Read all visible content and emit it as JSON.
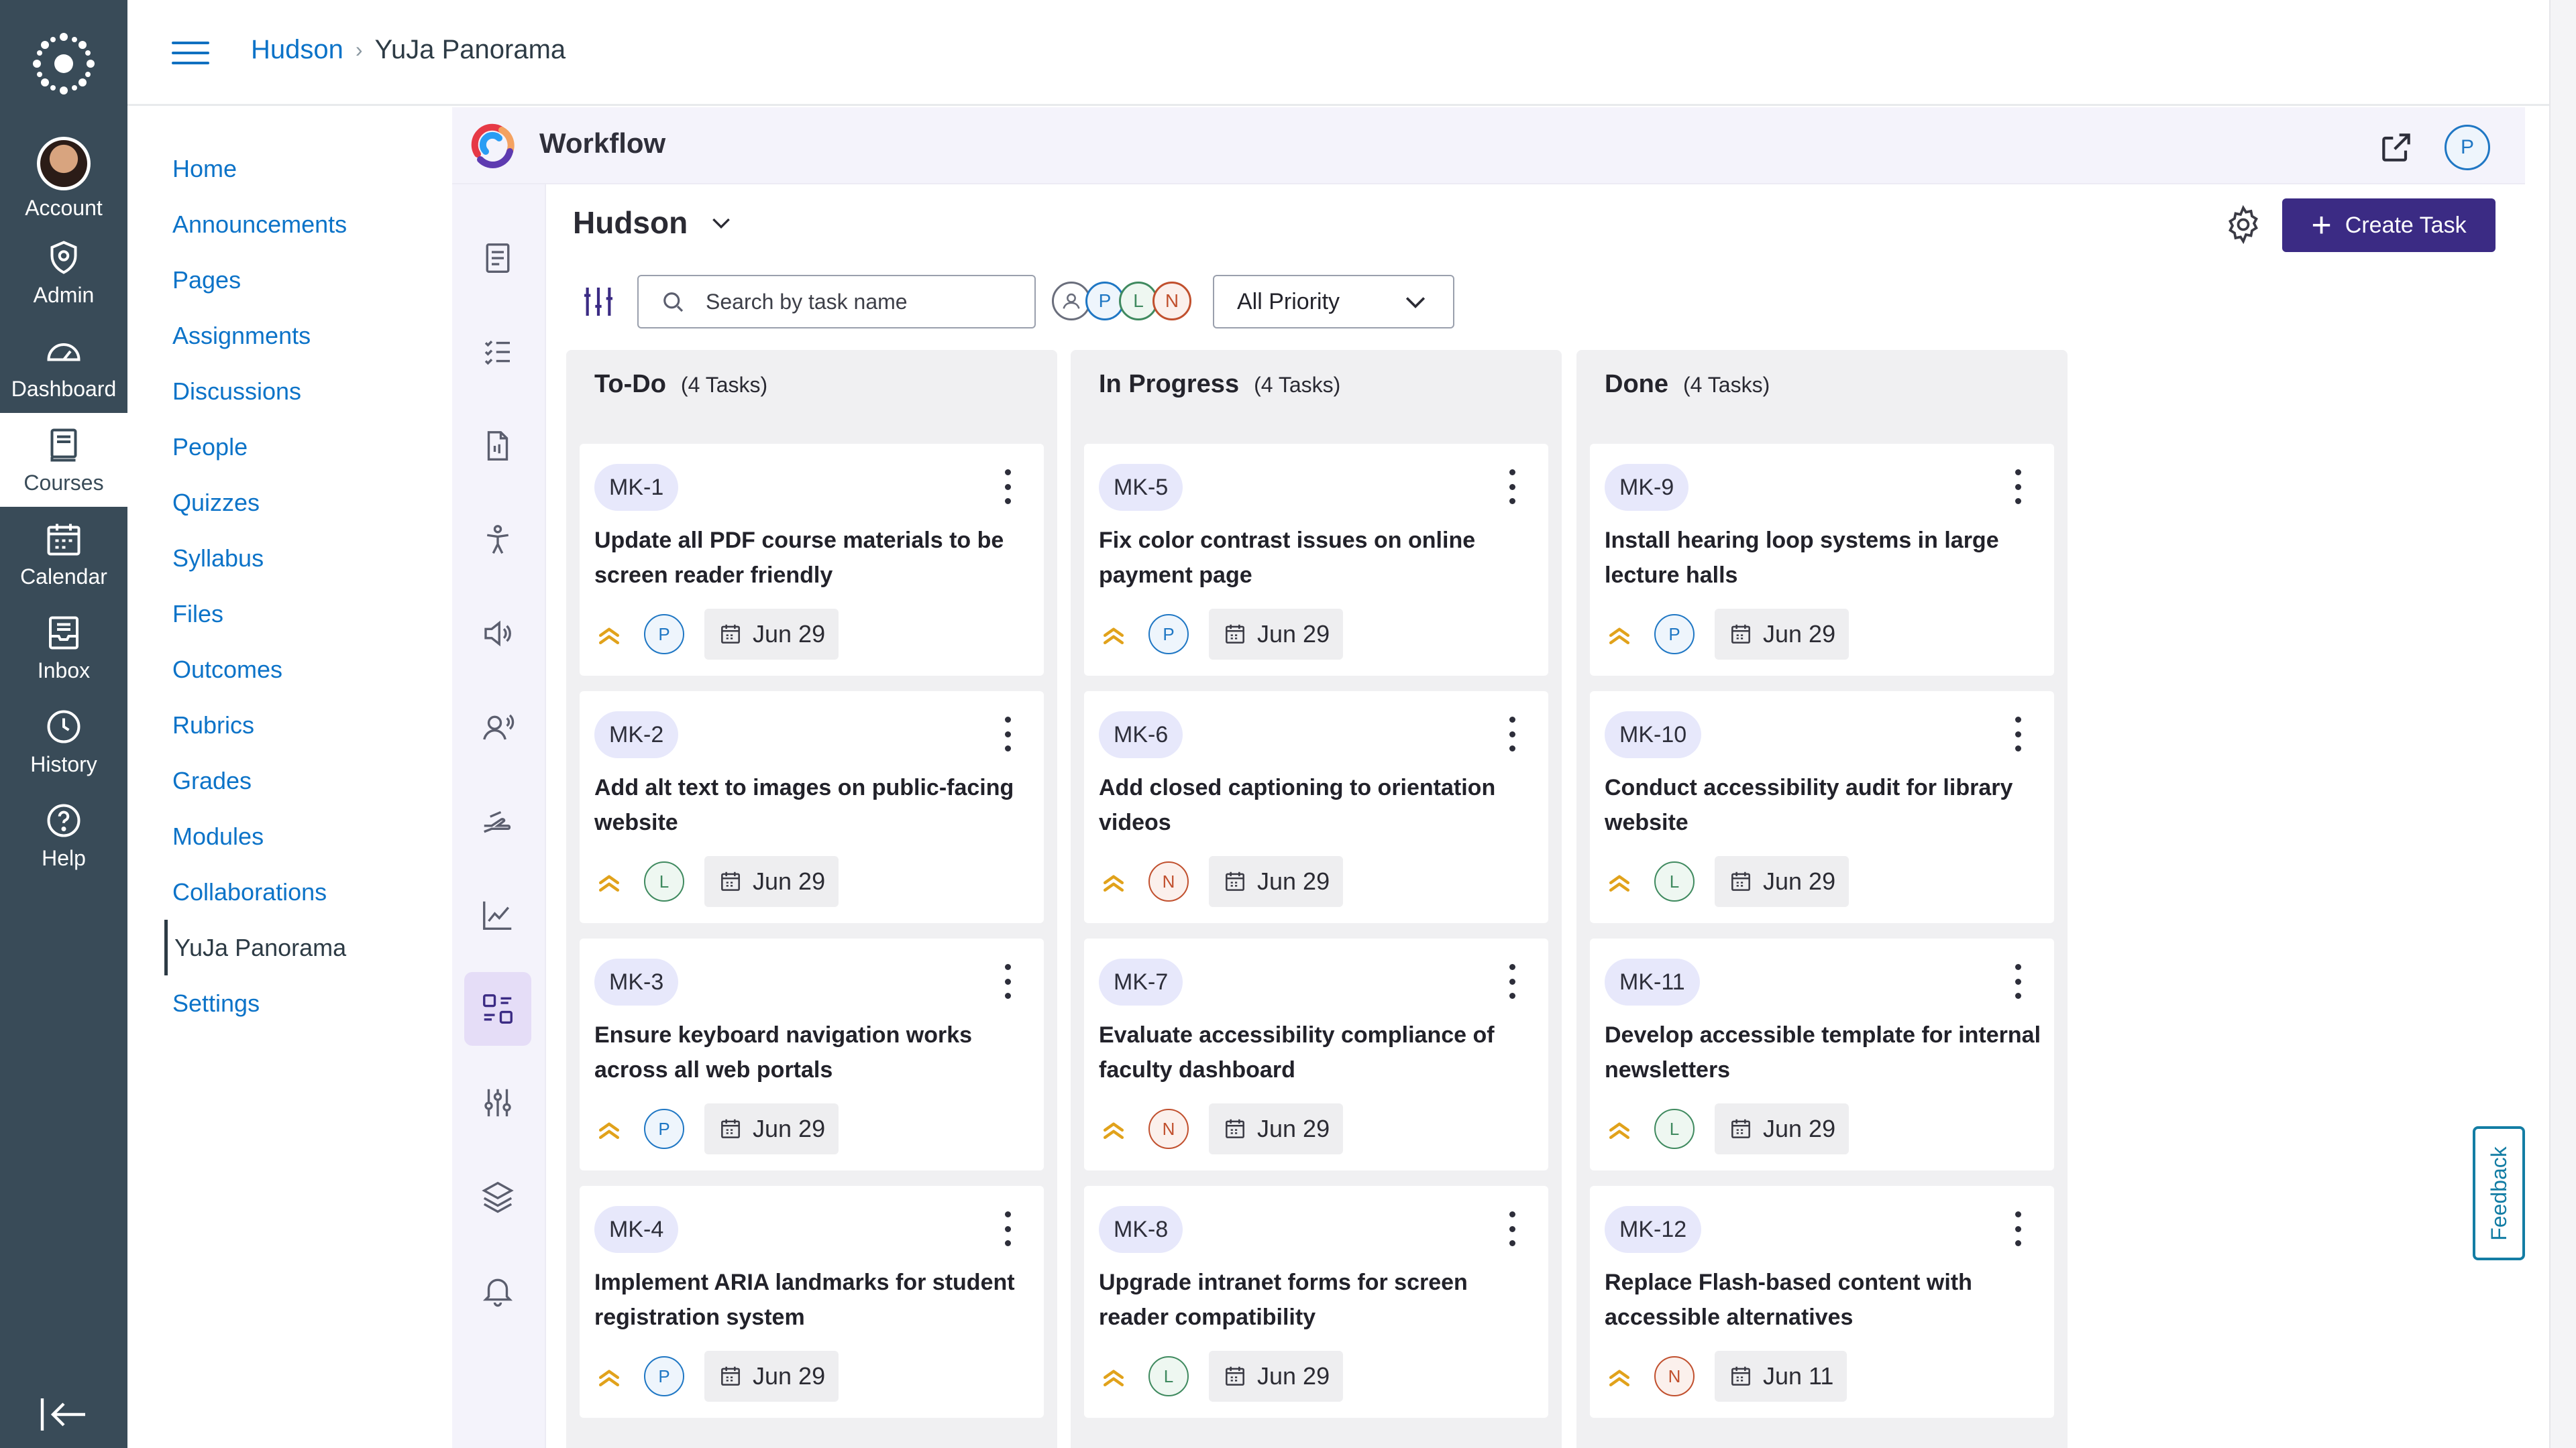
{
  "global_nav": {
    "items": [
      {
        "label": "Account",
        "icon": "account-avatar"
      },
      {
        "label": "Admin",
        "icon": "shield-icon"
      },
      {
        "label": "Dashboard",
        "icon": "speedometer-icon"
      },
      {
        "label": "Courses",
        "icon": "book-icon",
        "active": true
      },
      {
        "label": "Calendar",
        "icon": "calendar-icon"
      },
      {
        "label": "Inbox",
        "icon": "inbox-icon"
      },
      {
        "label": "History",
        "icon": "clock-icon"
      },
      {
        "label": "Help",
        "icon": "question-icon"
      }
    ]
  },
  "breadcrumb": {
    "course": "Hudson",
    "separator": "›",
    "page": "YuJa Panorama"
  },
  "course_nav": {
    "items": [
      {
        "label": "Home"
      },
      {
        "label": "Announcements"
      },
      {
        "label": "Pages"
      },
      {
        "label": "Assignments"
      },
      {
        "label": "Discussions"
      },
      {
        "label": "People"
      },
      {
        "label": "Quizzes"
      },
      {
        "label": "Syllabus"
      },
      {
        "label": "Files"
      },
      {
        "label": "Outcomes"
      },
      {
        "label": "Rubrics"
      },
      {
        "label": "Grades"
      },
      {
        "label": "Modules"
      },
      {
        "label": "Collaborations"
      },
      {
        "label": "YuJa Panorama",
        "active": true
      },
      {
        "label": "Settings"
      }
    ]
  },
  "app": {
    "title": "Workflow",
    "user_initial": "P",
    "board_name": "Hudson",
    "create_label": "Create Task",
    "search_placeholder": "Search by task name",
    "assignee_filter": [
      "P",
      "L",
      "N"
    ],
    "priority_filter": "All Priority",
    "feedback_label": "Feedback"
  },
  "colors": {
    "accent": "#3b2b84",
    "link": "#0c73c8",
    "nav_bg": "#394b58",
    "priority": "#e1a21b",
    "P": "#1f77c4",
    "L": "#3f8a5f",
    "N": "#c1502e"
  },
  "columns": [
    {
      "name": "To-Do",
      "count": "(4 Tasks)",
      "cards": [
        {
          "id": "MK-1",
          "title": "Update all PDF course materials to be screen reader friendly",
          "assignee": "P",
          "date": "Jun 29"
        },
        {
          "id": "MK-2",
          "title": "Add alt text to images on public-facing website",
          "assignee": "L",
          "date": "Jun 29"
        },
        {
          "id": "MK-3",
          "title": "Ensure keyboard navigation works across all web portals",
          "assignee": "P",
          "date": "Jun 29"
        },
        {
          "id": "MK-4",
          "title": "Implement ARIA landmarks for student registration system",
          "assignee": "P",
          "date": "Jun 29"
        }
      ]
    },
    {
      "name": "In Progress",
      "count": "(4 Tasks)",
      "cards": [
        {
          "id": "MK-5",
          "title": "Fix color contrast issues on online payment page",
          "assignee": "P",
          "date": "Jun 29"
        },
        {
          "id": "MK-6",
          "title": "Add closed captioning to orientation videos",
          "assignee": "N",
          "date": "Jun 29"
        },
        {
          "id": "MK-7",
          "title": "Evaluate accessibility compliance of faculty dashboard",
          "assignee": "N",
          "date": "Jun 29"
        },
        {
          "id": "MK-8",
          "title": "Upgrade intranet forms for screen reader compatibility",
          "assignee": "L",
          "date": "Jun 29"
        }
      ]
    },
    {
      "name": "Done",
      "count": "(4 Tasks)",
      "cards": [
        {
          "id": "MK-9",
          "title": "Install hearing loop systems in large lecture halls",
          "assignee": "P",
          "date": "Jun 29"
        },
        {
          "id": "MK-10",
          "title": "Conduct accessibility audit for library website",
          "assignee": "L",
          "date": "Jun 29"
        },
        {
          "id": "MK-11",
          "title": "Develop accessible template for internal newsletters",
          "assignee": "L",
          "date": "Jun 29"
        },
        {
          "id": "MK-12",
          "title": "Replace Flash-based content with accessible alternatives",
          "assignee": "N",
          "date": "Jun 11"
        }
      ]
    }
  ]
}
